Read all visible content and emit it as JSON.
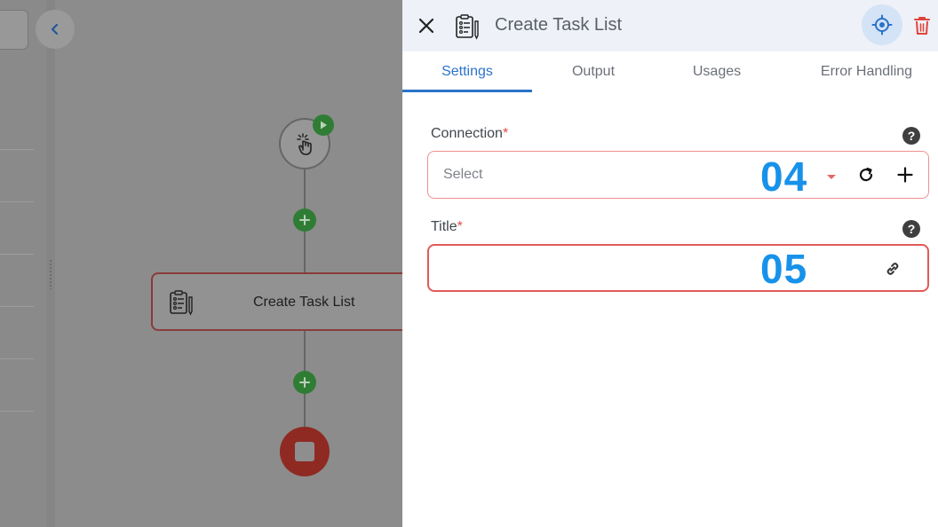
{
  "panel": {
    "title": "Create Task List",
    "tabs": [
      {
        "label": "Settings",
        "active": true
      },
      {
        "label": "Output",
        "active": false
      },
      {
        "label": "Usages",
        "active": false
      },
      {
        "label": "Error Handling",
        "active": false
      }
    ],
    "connection": {
      "label": "Connection",
      "required_marker": "*",
      "placeholder": "Select",
      "step_number": "04"
    },
    "title_field": {
      "label": "Title",
      "required_marker": "*",
      "value": "",
      "step_number": "05"
    },
    "help_glyph": "?"
  },
  "canvas": {
    "task_node_label": "Create Task List",
    "icons": [
      "chevron-left-icon",
      "tap-icon",
      "play-icon",
      "plus-icon",
      "clipboard-checklist-icon",
      "stop-icon"
    ]
  },
  "colors": {
    "accent": "#2a73c9",
    "required": "#e34b4b",
    "success": "#2f7d34",
    "danger": "#e0433b",
    "step_number": "#1792ea"
  }
}
